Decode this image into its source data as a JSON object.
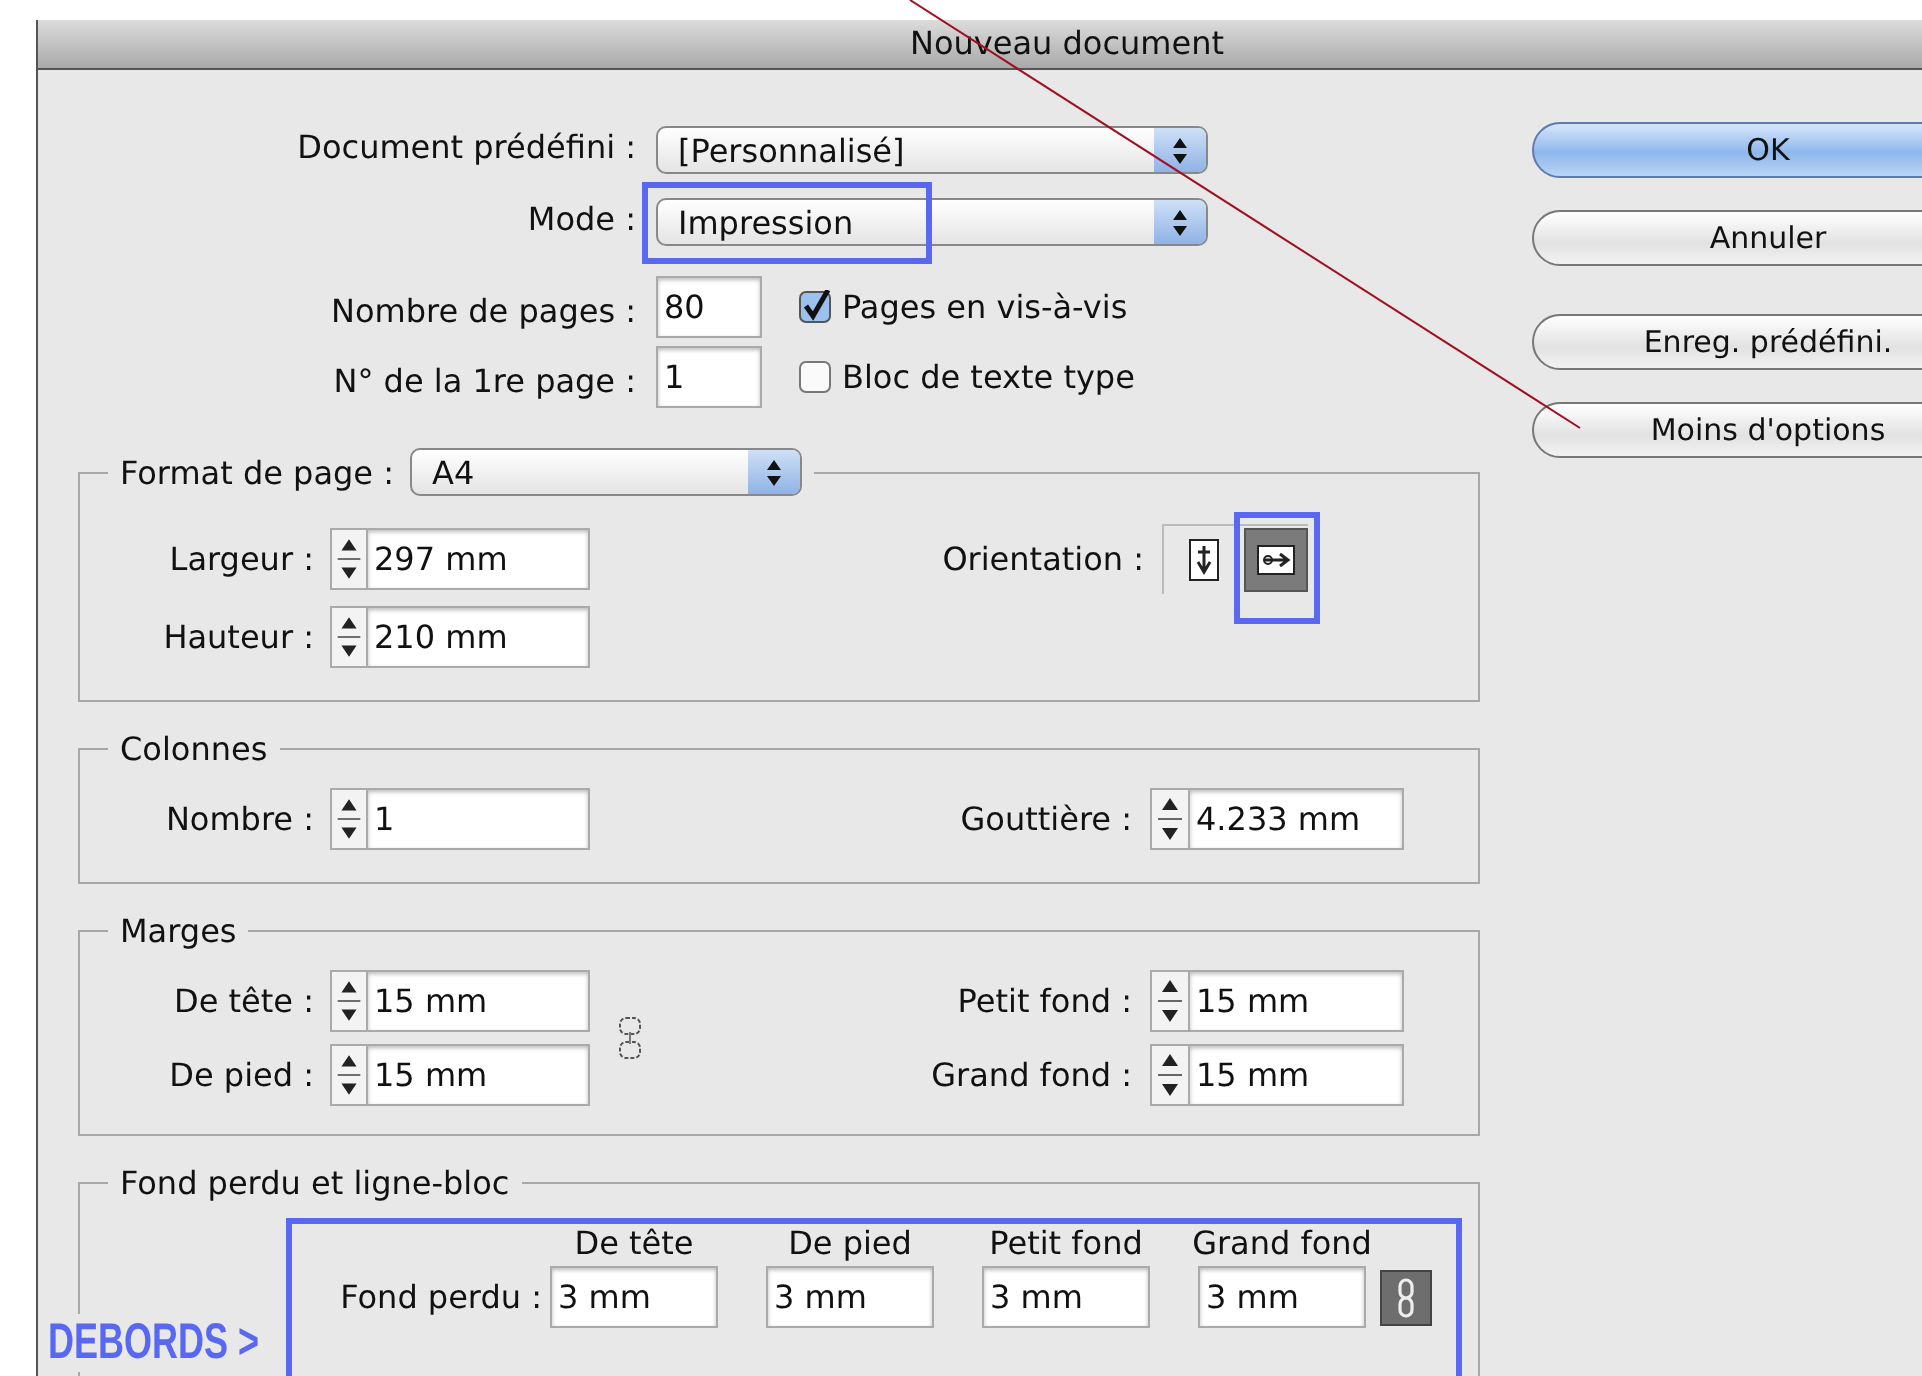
{
  "window": {
    "title": "Nouveau document"
  },
  "general": {
    "preset": {
      "label": "Document prédéfini :",
      "value": "[Personnalisé]"
    },
    "mode": {
      "label": "Mode :",
      "value": "Impression",
      "highlighted": true
    },
    "page_count": {
      "label": "Nombre de pages :",
      "value": "80"
    },
    "first_page": {
      "label": "N° de la 1re page :",
      "value": "1"
    },
    "checkboxes": [
      {
        "label": "Pages en vis-à-vis",
        "checked": true
      },
      {
        "label": "Bloc de texte type",
        "checked": false
      }
    ]
  },
  "buttons": [
    {
      "label": "OK",
      "default": true
    },
    {
      "label": "Annuler",
      "default": false
    },
    {
      "label": "Enreg. prédéfini.",
      "default": false
    },
    {
      "label": "Moins d'options",
      "default": false
    }
  ],
  "page_format": {
    "label": "Format de page :",
    "value": "A4",
    "fields": [
      {
        "label": "Largeur :",
        "value": "297 mm"
      },
      {
        "label": "Hauteur :",
        "value": "210 mm"
      }
    ],
    "orientation": {
      "label": "Orientation :",
      "options": [
        {
          "kind": "portrait",
          "selected": false,
          "highlighted": false
        },
        {
          "kind": "landscape",
          "selected": true,
          "highlighted": true
        }
      ]
    }
  },
  "columns": {
    "legend": "Colonnes",
    "number": {
      "label": "Nombre :",
      "value": "1"
    },
    "gutter": {
      "label": "Gouttière :",
      "value": "4.233 mm"
    }
  },
  "margins": {
    "legend": "Marges",
    "fields": [
      {
        "label": "De tête :",
        "value": "15 mm"
      },
      {
        "label": "Petit fond :",
        "value": "15 mm"
      },
      {
        "label": "De pied :",
        "value": "15 mm"
      },
      {
        "label": "Grand fond :",
        "value": "15 mm"
      }
    ],
    "linked": false
  },
  "bleed": {
    "legend": "Fond perdu et ligne-bloc",
    "callout": "DEBORDS >",
    "highlighted": true,
    "row_label": "Fond perdu :",
    "columns": [
      "De tête",
      "De pied",
      "Petit fond",
      "Grand fond"
    ],
    "values": [
      "3 mm",
      "3 mm",
      "3 mm",
      "3 mm"
    ],
    "linked": true
  }
}
